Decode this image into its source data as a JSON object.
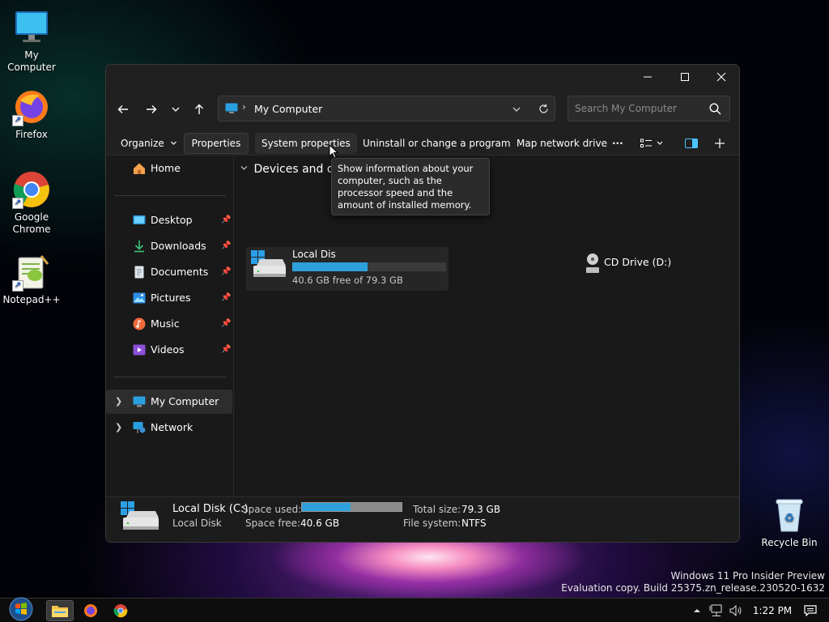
{
  "desktop": {
    "icons": [
      {
        "label": "My Computer",
        "icon": "computer-icon"
      },
      {
        "label": "Firefox",
        "icon": "firefox-icon"
      },
      {
        "label": "Google Chrome",
        "icon": "chrome-icon"
      },
      {
        "label": "Notepad++",
        "icon": "notepad-plus-plus-icon"
      },
      {
        "label": "Recycle Bin",
        "icon": "recycle-bin-icon"
      }
    ],
    "watermark": {
      "line1": "Windows 11 Pro Insider Preview",
      "line2": "Evaluation copy. Build 25375.zn_release.230520-1632"
    }
  },
  "window": {
    "address": {
      "location": "My Computer",
      "separator": "›"
    },
    "search": {
      "placeholder": "Search My Computer"
    },
    "toolbar": {
      "organize": "Organize",
      "properties": "Properties",
      "system_properties": "System properties",
      "uninstall": "Uninstall or change a program",
      "map_drive": "Map network drive",
      "more": "···"
    },
    "nav": {
      "home": "Home",
      "quick_access": [
        {
          "label": "Desktop"
        },
        {
          "label": "Downloads"
        },
        {
          "label": "Documents"
        },
        {
          "label": "Pictures"
        },
        {
          "label": "Music"
        },
        {
          "label": "Videos"
        }
      ],
      "my_computer": "My Computer",
      "network": "Network"
    },
    "content": {
      "group_header": "Devices and dr",
      "drives": [
        {
          "name": "Local Dis",
          "free_text": "40.6 GB free of 79.3 GB",
          "used_fraction": 0.49
        },
        {
          "name": "CD Drive (D:)"
        }
      ]
    },
    "tooltip": "Show information about your computer, such as the processor speed and the amount of installed memory.",
    "details": {
      "title": "Local Disk (C:)",
      "subtitle": "Local Disk",
      "space_used_label": "Space used:",
      "space_used_fraction": 0.49,
      "space_free_label": "Space free:",
      "space_free_value": "40.6 GB",
      "total_size_label": "Total size:",
      "total_size_value": "79.3 GB",
      "file_system_label": "File system:",
      "file_system_value": "NTFS"
    }
  },
  "taskbar": {
    "clock": "1:22 PM",
    "apps": [
      "start-orb-icon",
      "file-explorer-icon",
      "firefox-icon",
      "chrome-icon"
    ]
  },
  "colors": {
    "accent": "#2ea0dc",
    "window_bg": "#191919",
    "chrome_bg": "#202020"
  }
}
